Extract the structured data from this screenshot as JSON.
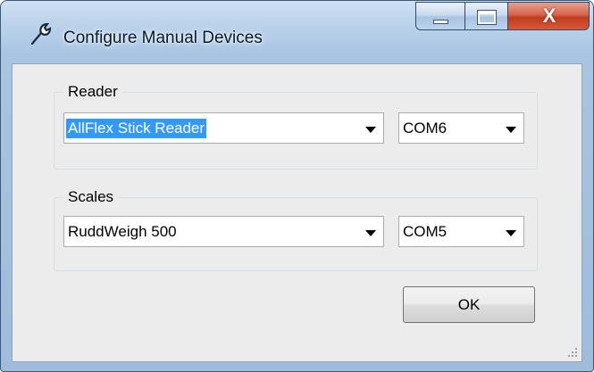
{
  "window": {
    "title": "Configure Manual Devices",
    "icon": "wrench-icon",
    "close_glyph": "X"
  },
  "reader": {
    "group_label": "Reader",
    "device_value": "AllFlex Stick Reader",
    "port_value": "COM6"
  },
  "scales": {
    "group_label": "Scales",
    "device_value": "RuddWeigh 500",
    "port_value": "COM5"
  },
  "buttons": {
    "ok_label": "OK"
  },
  "colors": {
    "selection": "#3399ff",
    "dialog_bg": "#ececec",
    "close_red": "#c23b1f"
  }
}
